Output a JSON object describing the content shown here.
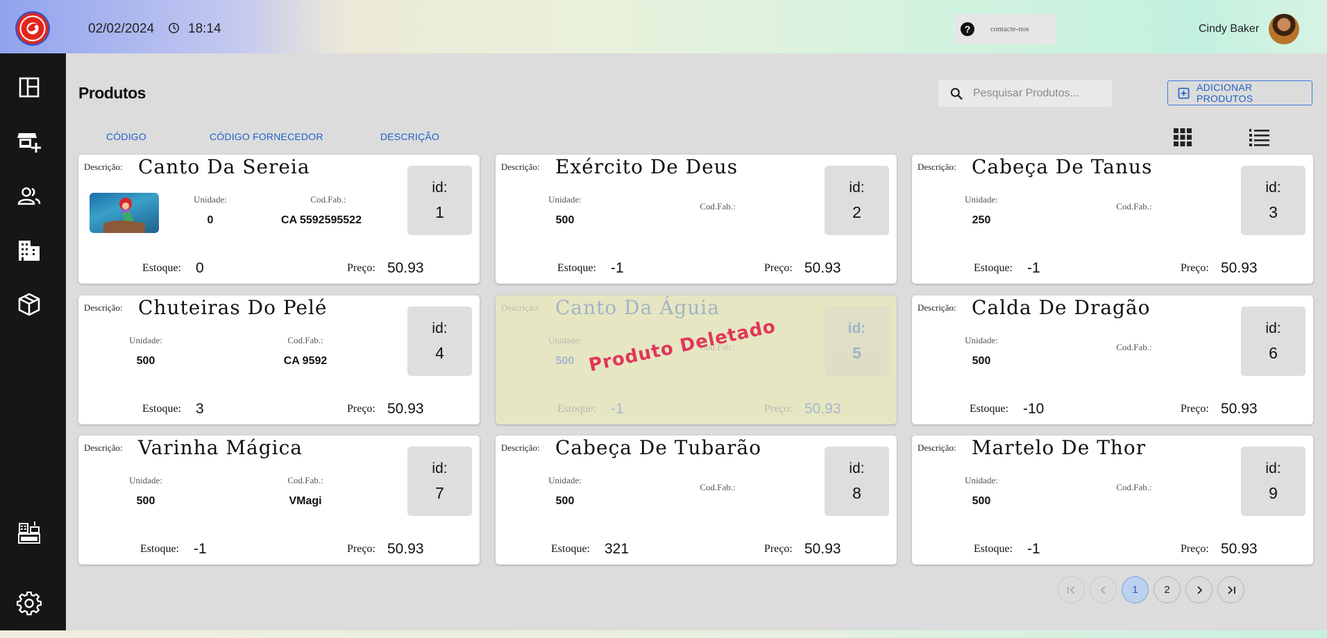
{
  "header": {
    "date": "02/02/2024",
    "time": "18:14",
    "contact_label": "contacte-nos",
    "user_name": "Cindy Baker"
  },
  "sidebar": {
    "items": [
      {
        "icon": "dashboard-icon"
      },
      {
        "icon": "store-add-icon"
      },
      {
        "icon": "users-icon"
      },
      {
        "icon": "buildings-icon"
      },
      {
        "icon": "box-icon"
      },
      {
        "icon": "cash-register-icon"
      },
      {
        "icon": "gear-icon"
      }
    ]
  },
  "page": {
    "title": "Produtos",
    "search_placeholder": "Pesquisar Produtos...",
    "add_button": "ADICIONAR PRODUTOS",
    "sort_tabs": [
      "CÓDIGO",
      "CÓDIGO FORNECEDOR",
      "DESCRIÇÃO"
    ]
  },
  "labels": {
    "descricao": "Descrição:",
    "unidade": "Unidade:",
    "codfab": "Cod.Fab.:",
    "id": "id:",
    "estoque": "Estoque:",
    "preco": "Preço:",
    "deleted": "Produto Deletado"
  },
  "products": [
    {
      "descricao": "Canto Da Sereia",
      "unidade": "0",
      "codfab": "CA 5592595522",
      "id": "1",
      "estoque": "0",
      "preco": "50.93"
    },
    {
      "descricao": "Exército De Deus",
      "unidade": "500",
      "codfab": "",
      "id": "2",
      "estoque": "-1",
      "preco": "50.93"
    },
    {
      "descricao": "Cabeça De Tanus",
      "unidade": "250",
      "codfab": "",
      "id": "3",
      "estoque": "-1",
      "preco": "50.93"
    },
    {
      "descricao": "Chuteiras Do Pelé",
      "unidade": "500",
      "codfab": "CA 9592",
      "id": "4",
      "estoque": "3",
      "preco": "50.93"
    },
    {
      "descricao": "Canto Da Águia",
      "unidade": "500",
      "codfab": "",
      "id": "5",
      "estoque": "-1",
      "preco": "50.93"
    },
    {
      "descricao": "Calda De Dragão",
      "unidade": "500",
      "codfab": "",
      "id": "6",
      "estoque": "-10",
      "preco": "50.93"
    },
    {
      "descricao": "Varinha Mágica",
      "unidade": "500",
      "codfab": "VMagi",
      "id": "7",
      "estoque": "-1",
      "preco": "50.93"
    },
    {
      "descricao": "Cabeça De Tubarão",
      "unidade": "500",
      "codfab": "",
      "id": "8",
      "estoque": "321",
      "preco": "50.93"
    },
    {
      "descricao": "Martelo De Thor",
      "unidade": "500",
      "codfab": "",
      "id": "9",
      "estoque": "-1",
      "preco": "50.93"
    }
  ],
  "pagination": {
    "pages": [
      "1",
      "2"
    ],
    "current": "1"
  },
  "colors": {
    "accent": "#1f5fc8",
    "sidebar": "#161616",
    "deleted_card": "#e6e6c2",
    "deleted_stamp": "#e0365a"
  }
}
